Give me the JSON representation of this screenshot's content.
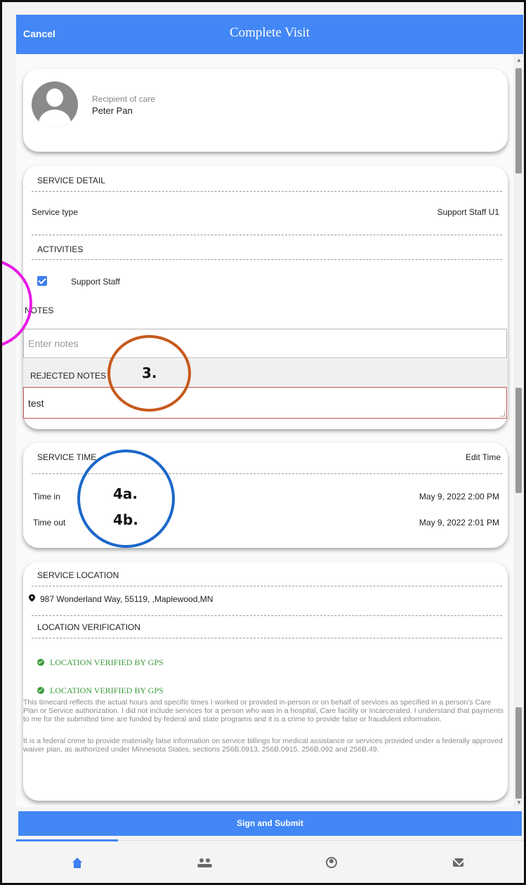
{
  "header": {
    "cancel_label": "Cancel",
    "title": "Complete Visit"
  },
  "recipient": {
    "label": "Recipient of care",
    "name": "Peter Pan"
  },
  "service_detail": {
    "title": "SERVICE DETAIL",
    "service_type_label": "Service type",
    "service_type_value": "Support Staff U1",
    "activities_title": "ACTIVITIES",
    "activity_label": "Support Staff",
    "activity_checked": true,
    "notes_title": "NOTES",
    "notes_placeholder": "Enter notes",
    "rejected_notes_title": "REJECTED NOTES",
    "rejected_notes_value": "test"
  },
  "service_time": {
    "title": "SERVICE TIME",
    "edit_label": "Edit Time",
    "time_in_label": "Time in",
    "time_in_value": "May 9, 2022 2:00 PM",
    "time_out_label": "Time out",
    "time_out_value": "May 9, 2022 2:01 PM"
  },
  "service_location": {
    "title": "SERVICE LOCATION",
    "address": "987 Wonderland Way, 55119, ,Maplewood,MN",
    "verification_title": "LOCATION VERIFICATION",
    "verified_1": "LOCATION VERIFIED BY GPS",
    "verified_2": "LOCATION VERIFIED BY GPS",
    "legal_1": "This timecard reflects the actual hours and specific times I worked or provided in-person or on behalf of services as specified in a person's Care Plan or Service authorization. I did not include services for a person who was in a hospital, Care facility or Incarcerated. I understand that payments to me for the submitted time are funded by federal and state programs and it is a crime to provide false or fraudulent information.",
    "legal_2": "It is a federal crime to provide materially false information on service billings for medical assistance or services provided under a federally approved waiver plan, as authorized under Minnesota States, sections 256B.0913, 256B.0915, 256B.092 and 256B.49."
  },
  "submit_label": "Sign and Submit",
  "bottom_nav": {
    "items": [
      "home-icon",
      "people-icon",
      "account-icon",
      "mail-icon"
    ],
    "active": "home-icon"
  },
  "annotations": {
    "label_3": "3.",
    "label_4a": "4a.",
    "label_4b": "4b."
  },
  "colors": {
    "primary": "#4287f5",
    "verified_green": "#3b9b3b",
    "annotation_pink": "#e91ae6",
    "annotation_orange": "#c65a1c",
    "annotation_blue": "#1b67c9"
  }
}
